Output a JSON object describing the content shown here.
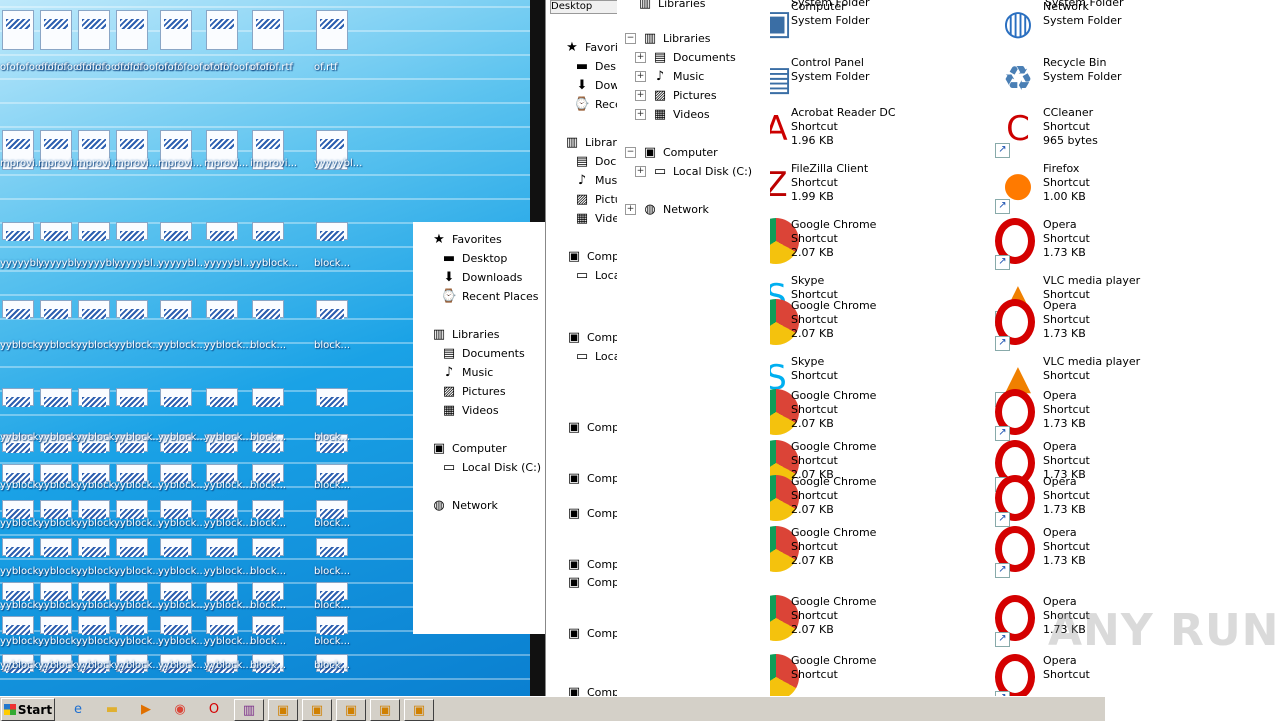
{
  "desktop": {
    "file_labels": [
      "ofofofoofof.rtf",
      "ofofof.rtf",
      "of.rtf",
      "mprovi...",
      "improvi...",
      "yyyyybl...",
      "yyblock...",
      "block..."
    ]
  },
  "nav_pane_small": {
    "items": [
      "Favorites",
      "Desktop",
      "Downloads",
      "Recent Places",
      "Libraries",
      "Documents",
      "Music",
      "Pictures",
      "Videos",
      "Computer",
      "Local Disk (C:)",
      "Network"
    ]
  },
  "nav_pane_right": {
    "items": [
      "Libraries",
      "Libraries",
      "Documents",
      "Music",
      "Pictures",
      "Videos",
      "Computer",
      "Local Disk (C:)",
      "Network"
    ]
  },
  "nav_pane_left_cut": {
    "items": [
      "Desktop",
      "Favori",
      "Deskt",
      "Dow",
      "Rece",
      "Librari",
      "Docu",
      "Musi",
      "Pictu",
      "Vide",
      "Comp",
      "Loca",
      "Comp",
      "Loca",
      "Comp",
      "Comp",
      "Comp",
      "Comp",
      "Comp",
      "Comp",
      "Comp"
    ]
  },
  "file_list": {
    "left_column": [
      {
        "name": "Computer",
        "type": "System Folder",
        "size": ""
      },
      {
        "name": "Control Panel",
        "type": "System Folder",
        "size": ""
      },
      {
        "name": "Acrobat Reader DC",
        "type": "Shortcut",
        "size": "1.96 KB"
      },
      {
        "name": "FileZilla Client",
        "type": "Shortcut",
        "size": "1.99 KB"
      },
      {
        "name": "Google Chrome",
        "type": "Shortcut",
        "size": "2.07 KB"
      },
      {
        "name": "Skype",
        "type": "Shortcut",
        "size": ""
      },
      {
        "name": "Google Chrome",
        "type": "Shortcut",
        "size": "2.07 KB"
      },
      {
        "name": "Skype",
        "type": "Shortcut",
        "size": ""
      },
      {
        "name": "Google Chrome",
        "type": "Shortcut",
        "size": "2.07 KB"
      },
      {
        "name": "Google Chrome",
        "type": "Shortcut",
        "size": "2.07 KB"
      },
      {
        "name": "Google Chrome",
        "type": "Shortcut",
        "size": "2.07 KB"
      },
      {
        "name": "Google Chrome",
        "type": "Shortcut",
        "size": "2.07 KB"
      },
      {
        "name": "Google Chrome",
        "type": "Shortcut",
        "size": "2.07 KB"
      },
      {
        "name": "Google Chrome",
        "type": "Shortcut",
        "size": ""
      }
    ],
    "right_column": [
      {
        "name": "Network",
        "type": "System Folder",
        "size": ""
      },
      {
        "name": "Recycle Bin",
        "type": "System Folder",
        "size": ""
      },
      {
        "name": "CCleaner",
        "type": "Shortcut",
        "size": "965 bytes"
      },
      {
        "name": "Firefox",
        "type": "Shortcut",
        "size": "1.00 KB"
      },
      {
        "name": "Opera",
        "type": "Shortcut",
        "size": "1.73 KB"
      },
      {
        "name": "VLC media player",
        "type": "Shortcut",
        "size": ""
      },
      {
        "name": "Opera",
        "type": "Shortcut",
        "size": "1.73 KB"
      },
      {
        "name": "VLC media player",
        "type": "Shortcut",
        "size": ""
      },
      {
        "name": "Opera",
        "type": "Shortcut",
        "size": "1.73 KB"
      },
      {
        "name": "Opera",
        "type": "Shortcut",
        "size": "1.73 KB"
      },
      {
        "name": "Opera",
        "type": "Shortcut",
        "size": "1.73 KB"
      },
      {
        "name": "Opera",
        "type": "Shortcut",
        "size": "1.73 KB"
      },
      {
        "name": "Opera",
        "type": "Shortcut",
        "size": "1.73 KB"
      },
      {
        "name": "Opera",
        "type": "Shortcut",
        "size": ""
      }
    ],
    "top_partial_left": "System Folder",
    "top_partial_right": "System Folder"
  },
  "taskbar": {
    "start_label": "Start",
    "buttons": [
      "ie-icon",
      "folder-icon",
      "media-player-icon",
      "chrome-icon",
      "opera-icon",
      "winrar-icon",
      "window-icon",
      "window-icon",
      "window-icon",
      "window-icon",
      "window-icon"
    ]
  },
  "watermark": "ANY RUN",
  "colors": {
    "desktop_blue": "#1aa2e6",
    "taskbar": "#d4d0c8",
    "opera_red": "#d40000"
  }
}
